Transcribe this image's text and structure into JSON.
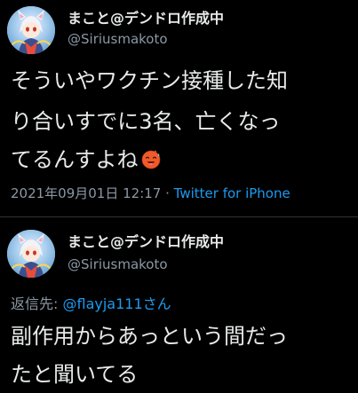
{
  "tweet": {
    "author": {
      "display_name": "まこと@デンドロ作成中",
      "handle": "@Siriusmakoto"
    },
    "text_lines": [
      "そういやワクチン接種した知",
      "り合いすでに3名、亡くなっ",
      "てるんすよね"
    ],
    "emoji": "hot-face-emoji",
    "timestamp": "2021年09月01日 12:17",
    "separator": " · ",
    "source": "Twitter for iPhone"
  },
  "reply": {
    "author": {
      "display_name": "まこと@デンドロ作成中",
      "handle": "@Siriusmakoto"
    },
    "reply_label": "返信先: ",
    "reply_mention": "@flayja111さん",
    "text_lines": [
      "副作用からあっという間だっ",
      "たと聞いてる"
    ]
  },
  "colors": {
    "background": "#000000",
    "text_primary": "#e7e9ea",
    "text_secondary": "#8b98a5",
    "accent": "#1d9bf0"
  }
}
